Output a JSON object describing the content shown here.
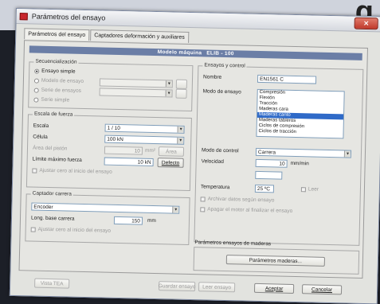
{
  "window": {
    "title": "Parámetros del ensayo",
    "close_glyph": "×"
  },
  "background": {
    "glyph": "q"
  },
  "tabs": [
    {
      "label": "Parámetros del ensayo",
      "active": true
    },
    {
      "label": "Captadores deformación y auxiliares"
    }
  ],
  "model": {
    "label": "Modelo máquina",
    "value": "ELIB - 100"
  },
  "secuencializacion": {
    "title": "Secuencialización",
    "options": [
      {
        "label": "Ensayo simple",
        "selected": true
      },
      {
        "label": "Modelo de ensayo"
      },
      {
        "label": "Serie de ensayos"
      },
      {
        "label": "Serie simple"
      }
    ]
  },
  "escala": {
    "title": "Escala de fuerza",
    "escala_label": "Escala",
    "escala_value": "1 / 10",
    "celula_label": "Célula",
    "celula_value": "100 kN",
    "area_label": "Área del pistón",
    "area_value": "10",
    "area_unit": "mm²",
    "area_button": "Área",
    "limite_label": "Límite máximo fuerza",
    "limite_value": "10 kN",
    "defecto_button": "Defecto",
    "check_label": "Ajustar cero al inicio del ensayo"
  },
  "captador": {
    "title": "Captador carrera",
    "value": "Encoder",
    "long_label": "Long. base carrera",
    "long_value": "150",
    "long_unit": "mm",
    "check_label": "Ajustar cero al inicio del ensayo"
  },
  "ensayos": {
    "title": "Ensayos y control",
    "nombre_label": "Nombre",
    "nombre_value": "EN1561 C",
    "modo_label": "Modo de ensayo",
    "modes": [
      "Compresión",
      "Flexión",
      "Tracción",
      "Maderas cara",
      "Maderas canto",
      "Maderas tableros",
      "Ciclos de compresión",
      "Ciclos de tracción"
    ],
    "selected_mode": 4,
    "control_label": "Modo de control",
    "control_value": "Carrera",
    "velocidad_label": "Velocidad",
    "velocidad_value": "10",
    "velocidad_unit": "mm/min",
    "temp_label": "Temperatura",
    "temp_value": "25 ºC",
    "temp_check": "Leer",
    "check1": "Archivar datos según ensayo",
    "check2": "Apagar el motor al finalizar el ensayo"
  },
  "maderas": {
    "title": "Parámetros ensayos de maderas",
    "button": "Parámetros maderas..."
  },
  "footer": {
    "b1": "Vista TEA",
    "b2": "Guardar ensayo",
    "b3": "Leer ensayo",
    "ok": "Aceptar",
    "cancel": "Cancelar"
  }
}
